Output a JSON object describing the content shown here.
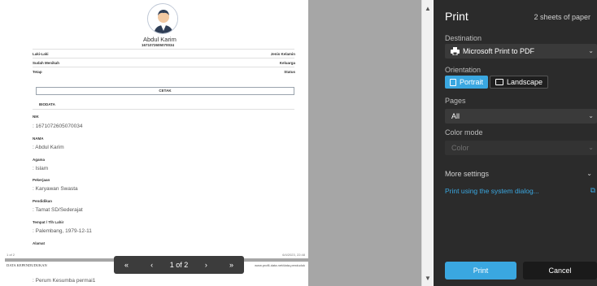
{
  "document": {
    "name": "Abdul Karim",
    "nik_top": "1671072605070034",
    "meta_rows": [
      {
        "left": "Laki-Laki",
        "right": "Jenis Kelamin"
      },
      {
        "left": "Sudah Menikah",
        "right": "Keluarga"
      },
      {
        "left": "Tetap",
        "right": "Status"
      }
    ],
    "cetak_label": "CETAK",
    "section_title": "BIODATA",
    "fields": [
      {
        "label": "NIK",
        "value": ": 1671072605070034"
      },
      {
        "label": "NAMA",
        "value": ": Abdul Karim"
      },
      {
        "label": "Agama",
        "value": ": Islam"
      },
      {
        "label": "Pekerjaan",
        "value": ": Karyawan Swasta"
      },
      {
        "label": "Pendidikan",
        "value": ": Tamat SD/Sederajat"
      },
      {
        "label": "Tempat / Tlh Lahir",
        "value": ": Palembang, 1979-12-11"
      },
      {
        "label": "Alamat",
        "value": ""
      }
    ],
    "footer_left": "1 of 2",
    "footer_right": "6/4/2023, 22:48",
    "page2_header_left": "DATA KEPENDUDUKAN",
    "page2_header_right": "www.profil-data.net/data-penduduk",
    "page2_line": ": Perum Kesumba permai1"
  },
  "page_nav": {
    "first": "«",
    "prev": "‹",
    "page_label": "1 of 2",
    "next": "›",
    "last": "»"
  },
  "scroll": {
    "up": "▲",
    "down": "▼"
  },
  "sidebar": {
    "title": "Print",
    "sheets": "2 sheets of paper",
    "destination_label": "Destination",
    "destination_value": "Microsoft Print to PDF",
    "orientation_label": "Orientation",
    "portrait": "Portrait",
    "landscape": "Landscape",
    "pages_label": "Pages",
    "pages_value": "All",
    "color_label": "Color mode",
    "color_value": "Color",
    "more_settings": "More settings",
    "system_dialog": "Print using the system dialog...",
    "print_button": "Print",
    "cancel_button": "Cancel",
    "chevron": "⌄",
    "external_icon": "⧉"
  },
  "colors": {
    "accent": "#3aa7e0",
    "sidebar_bg": "#2b2b2b",
    "preview_bg": "#a6a6a6"
  }
}
